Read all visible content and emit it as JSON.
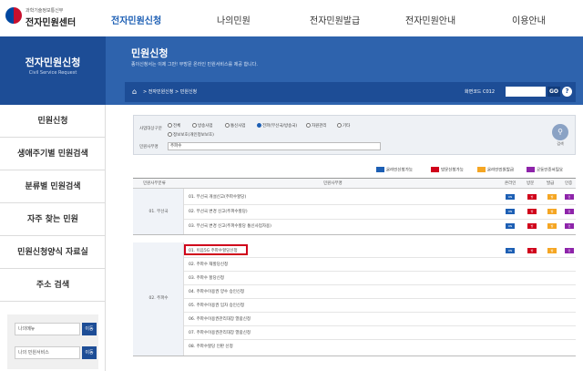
{
  "header": {
    "ministry": "과학기술정보통신부",
    "center": "전자민원센터",
    "nav": [
      "전자민원신청",
      "나의민원",
      "전자민원발급",
      "전자민원안내",
      "이용안내"
    ]
  },
  "sidebar": {
    "title": "전자민원신청",
    "subtitle": "Civil Service Request",
    "items": [
      "민원신청",
      "생애주기별 민원검색",
      "분류별 민원검색",
      "자주 찾는 민원",
      "민원신청양식 자료실",
      "주소 검색"
    ],
    "quick": [
      {
        "label": "나의메뉴",
        "btn": "이동"
      },
      {
        "label": "나의 민원서비스",
        "btn": "이동"
      }
    ]
  },
  "banner": {
    "title": "민원신청",
    "desc": "종이신청서는 이제 그만! 무방문 온라인 민원서비스를 제공 합니다.",
    "breadcrumb": "> 전자민원신청 > 민원신청",
    "screen_label": "화면코드 C012",
    "go": "GO",
    "help": "?"
  },
  "search": {
    "type_label": "사업대상구분",
    "radios": [
      {
        "label": "전체",
        "on": false
      },
      {
        "label": "방송사업",
        "on": false
      },
      {
        "label": "통신사업",
        "on": false
      },
      {
        "label": "전파(무선국/방송국)",
        "on": true
      },
      {
        "label": "자원관리",
        "on": false
      },
      {
        "label": "기타",
        "on": false
      }
    ],
    "radio_row2": "정보보호(개인정보보호)",
    "name_label": "민원사무명",
    "name_value": "주파수",
    "search_label": "검색"
  },
  "legend": [
    {
      "code": "ON",
      "label": "온라인신청가능",
      "color": "#1d5fb4"
    },
    {
      "code": "방",
      "label": "방문신청가능",
      "color": "#d0021b"
    },
    {
      "code": "발",
      "label": "온라인민원발급",
      "color": "#f5a623"
    },
    {
      "code": "인",
      "label": "공동인증서필요",
      "color": "#8e24aa"
    }
  ],
  "table": {
    "headers": [
      "민원사무분류",
      "민원사무명",
      "온라인",
      "방문",
      "발급",
      "인증"
    ],
    "groups": [
      {
        "name": "01. 무선국",
        "rows": [
          "01. 무선국 개설신고(주파수할당)",
          "02. 무선국 변경 신고(주파수할당)",
          "03. 무선국 변경 신고(주파수할당 통신사업자용)"
        ]
      },
      {
        "name": "02. 주파수",
        "rows": [
          "01. 이음5G 주파수할당신청",
          "02. 주파수 재할당신청",
          "03. 주파수 할당신청",
          "04. 주파수이용권 양수 승인신청",
          "05. 주파수이용권 임차 승인신청",
          "06. 주파수이용권관리대장 열람신청",
          "07. 주파수이용권관리대장 열람신청",
          "08. 주파수할당 인판 신청"
        ]
      }
    ]
  }
}
